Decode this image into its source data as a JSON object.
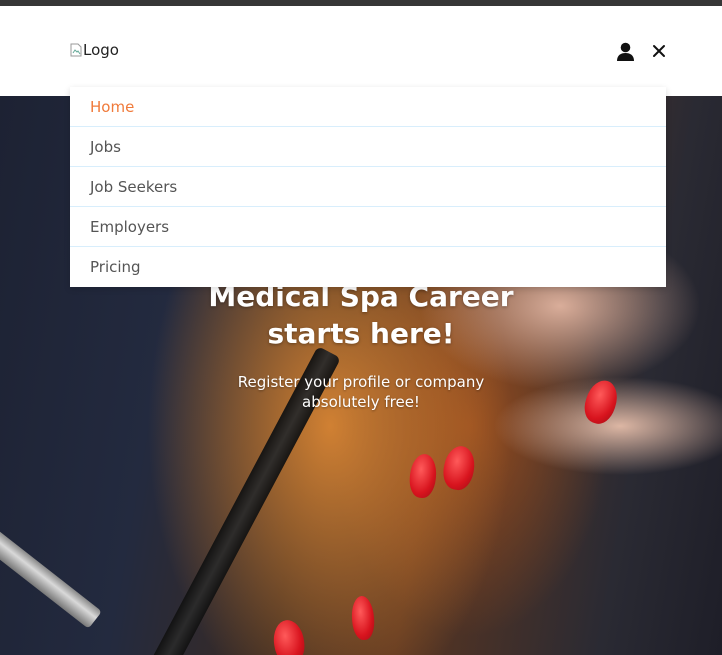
{
  "header": {
    "logo_alt": "Logo",
    "user_icon": "user-icon",
    "close_icon": "close-icon"
  },
  "menu": {
    "items": [
      {
        "label": "Home",
        "active": true
      },
      {
        "label": "Jobs",
        "active": false
      },
      {
        "label": "Job Seekers",
        "active": false
      },
      {
        "label": "Employers",
        "active": false
      },
      {
        "label": "Pricing",
        "active": false
      }
    ]
  },
  "hero": {
    "title_line1": "Medical Spa Career",
    "title_line2": "starts here!",
    "subtitle_line1": "Register your profile or company",
    "subtitle_line2": "absolutely free!"
  },
  "colors": {
    "accent": "#f07a3a",
    "top_bar": "#363636",
    "menu_divider": "#d8eefc"
  }
}
